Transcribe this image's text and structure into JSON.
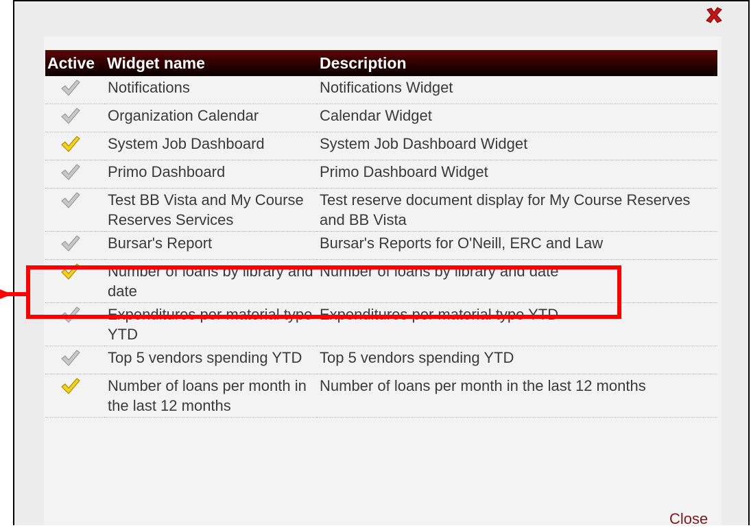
{
  "table": {
    "headers": {
      "active": "Active",
      "name": "Widget name",
      "description": "Description"
    },
    "rows": [
      {
        "active": false,
        "name": "Notifications",
        "description": "Notifications Widget"
      },
      {
        "active": false,
        "name": "Organization Calendar",
        "description": "Calendar Widget"
      },
      {
        "active": true,
        "name": "System Job Dashboard",
        "description": "System Job Dashboard Widget"
      },
      {
        "active": false,
        "name": "Primo Dashboard",
        "description": "Primo Dashboard Widget"
      },
      {
        "active": false,
        "name": "Test BB Vista and My Course Reserves Services",
        "description": "Test reserve document display for My Course Reserves and BB Vista"
      },
      {
        "active": false,
        "name": "Bursar's Report",
        "description": "Bursar's Reports for O'Neill, ERC and Law"
      },
      {
        "active": true,
        "name": "Number of loans by library and date",
        "description": "Number of loans by library and date"
      },
      {
        "active": false,
        "name": "Expenditures per material type YTD",
        "description": "Expenditures per material type YTD"
      },
      {
        "active": false,
        "name": "Top 5 vendors spending YTD",
        "description": "Top 5 vendors spending YTD"
      },
      {
        "active": true,
        "name": "Number of loans per month in the last 12 months",
        "description": "Number of loans per month in the last 12 months"
      }
    ]
  },
  "footer": {
    "close_label": "Close"
  },
  "icons": {
    "dialog_close": "close-x-icon",
    "active_check": "checkmark-icon"
  },
  "colors": {
    "check_active": "#f2d21c",
    "check_inactive": "#c8c8c8",
    "highlight": "#ff0000",
    "header_bg": "#2b0000",
    "close_x": "#c4141a",
    "close_link": "#7b1a1a"
  }
}
